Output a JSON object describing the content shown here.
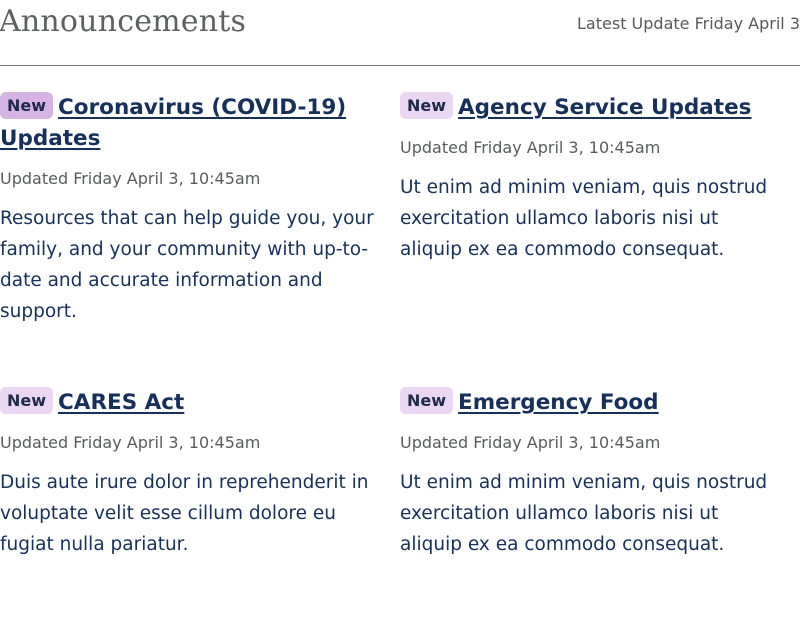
{
  "header": {
    "title": "Announcements",
    "latest_update": "Latest Update Friday April 3"
  },
  "announcements": [
    {
      "badge": "New",
      "title": "Coronavirus (COVID-19) Updates",
      "updated": "Updated Friday April 3, 10:45am",
      "description": "Resources that can help guide you, your family, and your community with up-to-date and accurate information and support."
    },
    {
      "badge": "New",
      "title": "Agency Service Updates",
      "updated": "Updated Friday April 3, 10:45am",
      "description": "Ut enim ad minim veniam, quis nostrud exercitation ullamco laboris nisi ut aliquip ex ea commodo consequat."
    },
    {
      "badge": "New",
      "title": "CARES Act",
      "updated": "Updated Friday April 3, 10:45am",
      "description": "Duis aute irure dolor in reprehenderit in voluptate velit esse cillum dolore eu fugiat nulla pariatur."
    },
    {
      "badge": "New",
      "title": "Emergency Food",
      "updated": "Updated Friday April 3, 10:45am",
      "description": "Ut enim ad minim veniam, quis nostrud exercitation ullamco laboris nisi ut aliquip ex ea commodo consequat."
    }
  ],
  "colors": {
    "link": "#16305b",
    "badge_highlight": "#d6b3e2",
    "badge": "#ead5f2",
    "muted_text": "#5a5b5f",
    "divider": "#6f6f6f"
  }
}
